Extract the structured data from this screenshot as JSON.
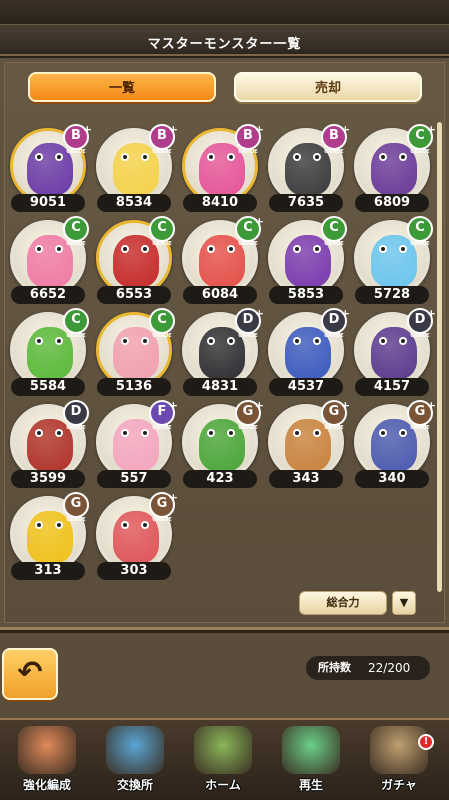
{
  "header": {
    "title": "マスターモンスター一覧"
  },
  "tabs": [
    {
      "label": "一覧",
      "active": true
    },
    {
      "label": "売却",
      "active": false
    }
  ],
  "monsters": [
    {
      "power": "9051",
      "grade": "B",
      "plus": true,
      "color": "#6a3aa8",
      "frame": "gold"
    },
    {
      "power": "8534",
      "grade": "B",
      "plus": true,
      "color": "#f5d34a",
      "frame": "silver"
    },
    {
      "power": "8410",
      "grade": "B",
      "plus": true,
      "color": "#e6559a",
      "frame": "gold"
    },
    {
      "power": "7635",
      "grade": "B",
      "plus": true,
      "color": "#3a3a3e",
      "frame": "silver"
    },
    {
      "power": "6809",
      "grade": "C",
      "plus": true,
      "color": "#6a3a9a",
      "frame": "silver"
    },
    {
      "power": "6652",
      "grade": "C",
      "plus": false,
      "color": "#f07aa6",
      "frame": "silver"
    },
    {
      "power": "6553",
      "grade": "C",
      "plus": false,
      "color": "#c62a2a",
      "frame": "gold"
    },
    {
      "power": "6084",
      "grade": "C",
      "plus": true,
      "color": "#e5504a",
      "frame": "silver"
    },
    {
      "power": "5853",
      "grade": "C",
      "plus": false,
      "color": "#7a3ab0",
      "frame": "silver"
    },
    {
      "power": "5728",
      "grade": "C",
      "plus": false,
      "color": "#6ac6f0",
      "frame": "silver"
    },
    {
      "power": "5584",
      "grade": "C",
      "plus": false,
      "color": "#5aba3a",
      "frame": "silver"
    },
    {
      "power": "5136",
      "grade": "C",
      "plus": false,
      "color": "#f2a0b0",
      "frame": "gold"
    },
    {
      "power": "4831",
      "grade": "D",
      "plus": true,
      "color": "#2e2e33",
      "frame": "silver"
    },
    {
      "power": "4537",
      "grade": "D",
      "plus": true,
      "color": "#3a5ac0",
      "frame": "silver"
    },
    {
      "power": "4157",
      "grade": "D",
      "plus": true,
      "color": "#5a3a90",
      "frame": "silver"
    },
    {
      "power": "3599",
      "grade": "D",
      "plus": false,
      "color": "#b0322a",
      "frame": "silver"
    },
    {
      "power": "557",
      "grade": "F",
      "plus": true,
      "color": "#f4a6c0",
      "frame": "silver"
    },
    {
      "power": "423",
      "grade": "G",
      "plus": true,
      "color": "#4aa63a",
      "frame": "silver"
    },
    {
      "power": "343",
      "grade": "G",
      "plus": true,
      "color": "#c9833e",
      "frame": "silver"
    },
    {
      "power": "340",
      "grade": "G",
      "plus": true,
      "color": "#4a5ab0",
      "frame": "silver"
    },
    {
      "power": "313",
      "grade": "G",
      "plus": false,
      "color": "#f0c21a",
      "frame": "silver"
    },
    {
      "power": "303",
      "grade": "G",
      "plus": true,
      "color": "#e0555a",
      "frame": "silver"
    }
  ],
  "badge_small_text": "GRADE",
  "sort": {
    "label": "総合力",
    "arrow_icon": "▼"
  },
  "back": {
    "icon": "↶"
  },
  "count": {
    "label": "所持数",
    "value": "22/200"
  },
  "nav": [
    {
      "label": "強化編成",
      "icon": "strengthen-icon",
      "color": "#e08a5a",
      "alert": ""
    },
    {
      "label": "交換所",
      "icon": "shop-icon",
      "color": "#5aa6d6",
      "alert": ""
    },
    {
      "label": "ホーム",
      "icon": "home-icon",
      "color": "#8ab65a",
      "alert": ""
    },
    {
      "label": "再生",
      "icon": "regenerate-icon",
      "color": "#6ad08a",
      "alert": ""
    },
    {
      "label": "ガチャ",
      "icon": "gacha-icon",
      "color": "#c0a070",
      "alert": "!"
    }
  ]
}
